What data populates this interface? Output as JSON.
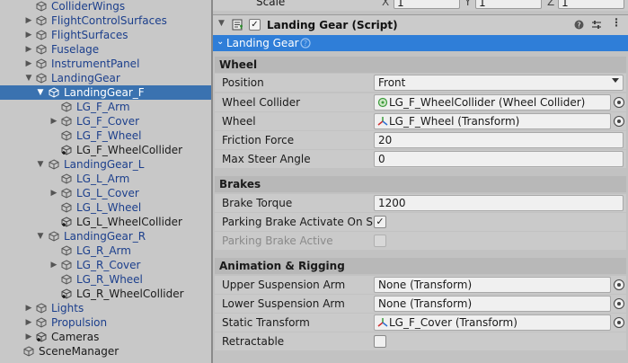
{
  "hierarchy": {
    "items": [
      {
        "label": "ColliderWings",
        "expand": "none"
      },
      {
        "label": "FlightControlSurfaces",
        "expand": "collapsed"
      },
      {
        "label": "FlightSurfaces",
        "expand": "collapsed"
      },
      {
        "label": "Fuselage",
        "expand": "collapsed"
      },
      {
        "label": "InstrumentPanel",
        "expand": "collapsed"
      },
      {
        "label": "LandingGear",
        "expand": "expanded"
      },
      {
        "label": "LandingGear_F",
        "expand": "expanded",
        "selected": true
      },
      {
        "label": "LG_F_Arm",
        "expand": "none"
      },
      {
        "label": "LG_F_Cover",
        "expand": "collapsed"
      },
      {
        "label": "LG_F_Wheel",
        "expand": "none"
      },
      {
        "label": "LG_F_WheelCollider",
        "expand": "none"
      },
      {
        "label": "LandingGear_L",
        "expand": "expanded"
      },
      {
        "label": "LG_L_Arm",
        "expand": "none"
      },
      {
        "label": "LG_L_Cover",
        "expand": "collapsed"
      },
      {
        "label": "LG_L_Wheel",
        "expand": "none"
      },
      {
        "label": "LG_L_WheelCollider",
        "expand": "none"
      },
      {
        "label": "LandingGear_R",
        "expand": "expanded"
      },
      {
        "label": "LG_R_Arm",
        "expand": "none"
      },
      {
        "label": "LG_R_Cover",
        "expand": "collapsed"
      },
      {
        "label": "LG_R_Wheel",
        "expand": "none"
      },
      {
        "label": "LG_R_WheelCollider",
        "expand": "none"
      },
      {
        "label": "Lights",
        "expand": "collapsed"
      },
      {
        "label": "Propulsion",
        "expand": "collapsed"
      },
      {
        "label": "Cameras",
        "expand": "collapsed"
      },
      {
        "label": "SceneManager",
        "expand": "none"
      }
    ]
  },
  "transform": {
    "scale_label": "Scale",
    "x_label": "X",
    "x_value": "1",
    "y_label": "Y",
    "y_value": "1",
    "z_label": "Z",
    "z_value": "1"
  },
  "component": {
    "title": "Landing Gear (Script)",
    "enabled": true,
    "subheader": "Landing Gear",
    "help_icon": "question-circle-icon"
  },
  "wheel": {
    "section_label": "Wheel",
    "position_label": "Position",
    "position_value": "Front",
    "collider_label": "Wheel Collider",
    "collider_value": "LG_F_WheelCollider (Wheel Collider)",
    "wheel_label": "Wheel",
    "wheel_value": "LG_F_Wheel (Transform)",
    "friction_label": "Friction Force",
    "friction_value": "20",
    "steer_label": "Max Steer Angle",
    "steer_value": "0"
  },
  "brakes": {
    "section_label": "Brakes",
    "torque_label": "Brake Torque",
    "torque_value": "1200",
    "parking_on_start_label": "Parking Brake Activate On Start",
    "parking_on_start_checked": "✓",
    "parking_active_label": "Parking Brake Active"
  },
  "animation": {
    "section_label": "Animation & Rigging",
    "upper_label": "Upper Suspension Arm",
    "upper_value": "None (Transform)",
    "lower_label": "Lower Suspension Arm",
    "lower_value": "None (Transform)",
    "static_label": "Static Transform",
    "static_value": "LG_F_Cover (Transform)",
    "retractable_label": "Retractable"
  },
  "colors": {
    "selection": "#3a72b0",
    "subheader_blue": "#2f7ed8",
    "hierarchy_link": "#1c3f8c"
  }
}
